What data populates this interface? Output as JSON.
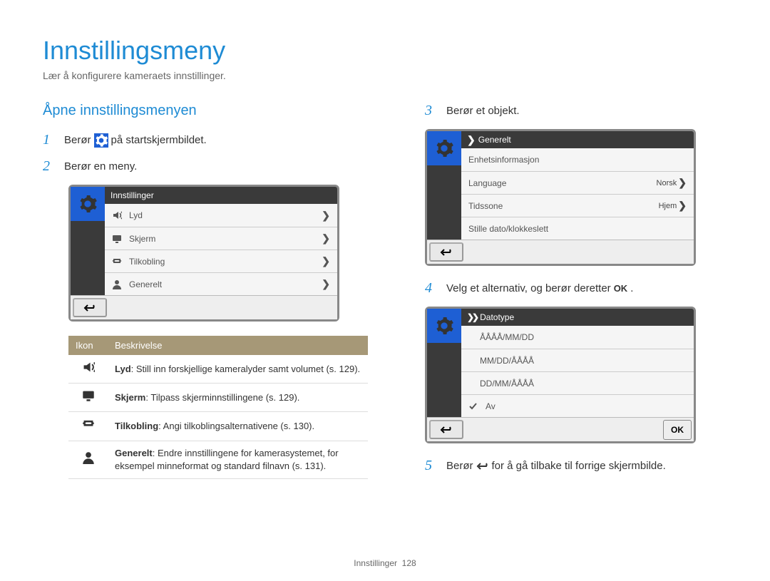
{
  "page": {
    "title": "Innstillingsmeny",
    "subtitle": "Lær å konfigurere kameraets innstillinger."
  },
  "left": {
    "section_title": "Åpne innstillingsmenyen",
    "steps": {
      "one_num": "1",
      "one_pre": "Berør ",
      "one_post": " på startskjermbildet.",
      "two_num": "2",
      "two_text": "Berør en meny."
    },
    "device": {
      "header": "Innstillinger",
      "rows": [
        {
          "label": "Lyd"
        },
        {
          "label": "Skjerm"
        },
        {
          "label": "Tilkobling"
        },
        {
          "label": "Generelt"
        }
      ]
    },
    "table": {
      "col_ikon": "Ikon",
      "col_besk": "Beskrivelse",
      "rows": [
        {
          "title": "Lyd",
          "desc": ": Still inn forskjellige kameralyder samt volumet (s. 129)."
        },
        {
          "title": "Skjerm",
          "desc": ": Tilpass skjerminnstillingene (s. 129)."
        },
        {
          "title": "Tilkobling",
          "desc": ": Angi tilkoblingsalternativene (s. 130)."
        },
        {
          "title": "Generelt",
          "desc": ": Endre innstillingene for kamerasystemet, for eksempel minneformat og standard filnavn (s. 131)."
        }
      ]
    }
  },
  "right": {
    "steps": {
      "three_num": "3",
      "three_text": "Berør et objekt.",
      "four_num": "4",
      "four_pre": "Velg et alternativ, og berør deretter ",
      "four_ok": "OK",
      "four_post": ".",
      "five_num": "5",
      "five_pre": "Berør ",
      "five_post": " for å gå tilbake til forrige skjermbilde."
    },
    "device1": {
      "header": "Generelt",
      "rows": [
        {
          "label": "Enhetsinformasjon",
          "value": ""
        },
        {
          "label": "Language",
          "value": "Norsk"
        },
        {
          "label": "Tidssone",
          "value": "Hjem"
        },
        {
          "label": "Stille dato/klokkeslett",
          "value": ""
        }
      ]
    },
    "device2": {
      "header": "Datotype",
      "rows": [
        {
          "label": "ÅÅÅÅ/MM/DD"
        },
        {
          "label": "MM/DD/ÅÅÅÅ"
        },
        {
          "label": "DD/MM/ÅÅÅÅ"
        },
        {
          "label": "Av",
          "checked": true
        }
      ],
      "ok": "OK"
    }
  },
  "footer": {
    "section": "Innstillinger",
    "page_num": "128"
  }
}
